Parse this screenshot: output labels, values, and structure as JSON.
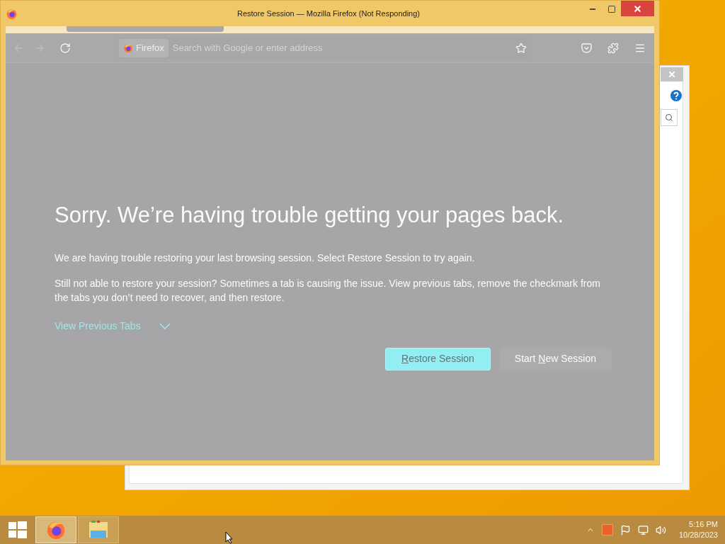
{
  "window": {
    "title": "Restore Session — Mozilla Firefox (Not Responding)"
  },
  "toolbar": {
    "identity_label": "Firefox",
    "address_placeholder": "Search with Google or enter address"
  },
  "page": {
    "heading": "Sorry. We’re having trouble getting your pages back.",
    "paragraphs": [
      "We are having trouble restoring your last browsing session. Select Restore Session to try again.",
      "Still not able to restore your session? Sometimes a tab is causing the issue. View previous tabs, remove the checkmark from the tabs you don’t need to recover, and then restore."
    ],
    "view_previous_tabs": {
      "label": "View Previous Tabs",
      "expanded": false
    },
    "buttons": [
      {
        "kind": "primary",
        "key": "R",
        "after": "estore Session"
      },
      {
        "kind": "secondary",
        "before": "Start ",
        "key": "N",
        "after": "ew Session"
      }
    ]
  },
  "taskbar": {
    "apps": [
      {
        "kind": "firefox",
        "selected": true
      },
      {
        "kind": "explorer",
        "selected": false
      }
    ],
    "time": "5:16 PM",
    "date": "10/28/2023"
  }
}
